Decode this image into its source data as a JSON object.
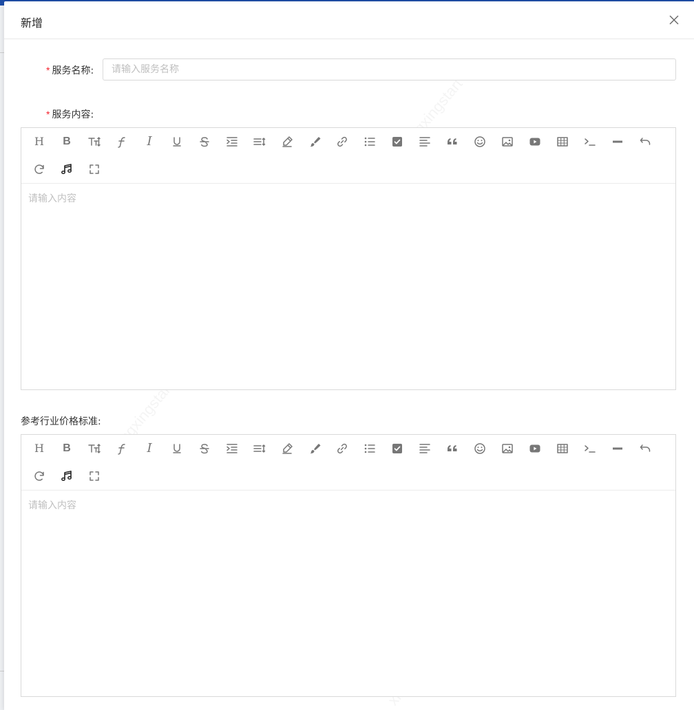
{
  "dialog": {
    "title": "新增"
  },
  "form": {
    "service_name": {
      "label": "服务名称:",
      "required_mark": "*",
      "value": "",
      "placeholder": "请输入服务名称"
    },
    "service_content": {
      "label": "服务内容:",
      "required_mark": "*",
      "placeholder": "请输入内容"
    },
    "price_standard": {
      "label": "参考行业价格标准:",
      "placeholder": "请输入内容"
    }
  },
  "toolbar": {
    "icons": [
      "heading-icon",
      "bold-icon",
      "font-size-icon",
      "font-family-icon",
      "italic-icon",
      "underline-icon",
      "strikethrough-icon",
      "indent-icon",
      "line-height-icon",
      "font-color-icon",
      "background-color-icon",
      "link-icon",
      "bullet-list-icon",
      "todo-icon",
      "align-icon",
      "quote-icon",
      "emoji-icon",
      "image-icon",
      "video-icon",
      "table-icon",
      "code-icon",
      "divider-icon",
      "undo-icon",
      "redo-icon",
      "audio-icon",
      "fullscreen-icon"
    ],
    "heading_glyph": "H",
    "bold_glyph": "B",
    "italic_glyph": "I"
  },
  "watermark": {
    "lines": [
      "xingxingstart",
      "dt",
      "20221104"
    ]
  },
  "colors": {
    "required": "#f5222d",
    "border": "#d9d9d9",
    "placeholder": "#bfbfbf",
    "icon": "#777777",
    "top_bar": "#1f4fa8"
  }
}
